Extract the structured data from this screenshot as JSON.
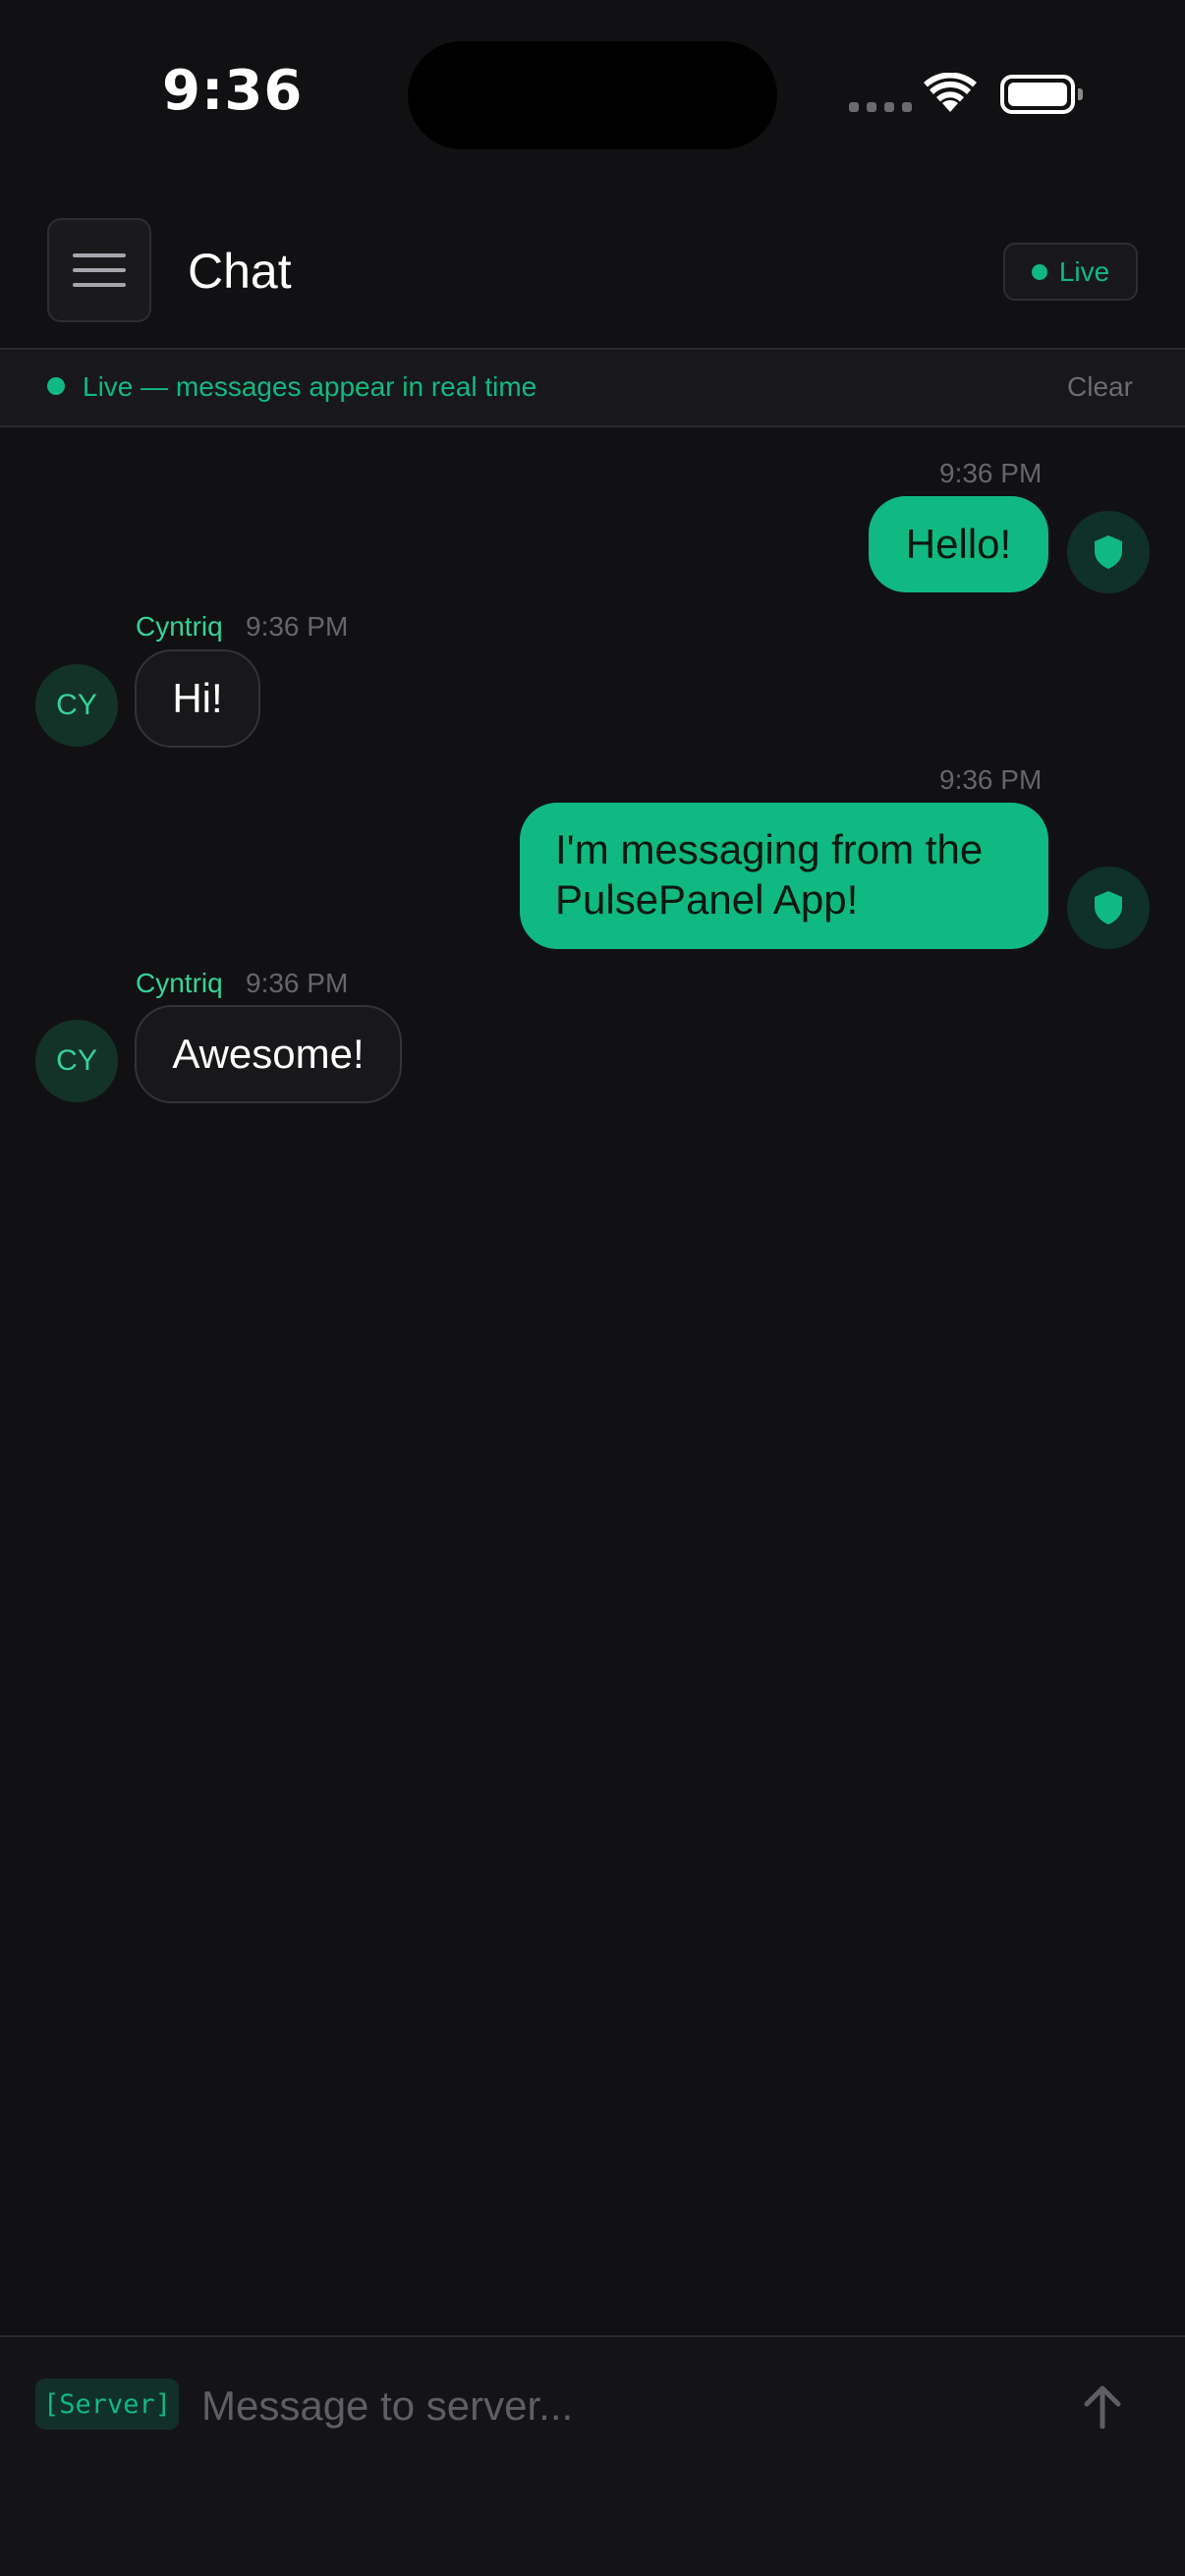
{
  "status_bar": {
    "time": "9:36"
  },
  "header": {
    "title": "Chat",
    "live_label": "Live"
  },
  "banner": {
    "text": "Live — messages appear in real time",
    "clear_label": "Clear"
  },
  "messages": [
    {
      "direction": "outgoing",
      "time": "9:36 PM",
      "text": "Hello!"
    },
    {
      "direction": "incoming",
      "sender": "Cyntriq",
      "initials": "CY",
      "time": "9:36 PM",
      "text": "Hi!"
    },
    {
      "direction": "outgoing",
      "time": "9:36 PM",
      "text": "I'm messaging from the PulsePanel App!"
    },
    {
      "direction": "incoming",
      "sender": "Cyntriq",
      "initials": "CY",
      "time": "9:36 PM",
      "text": "Awesome!"
    }
  ],
  "composer": {
    "target_tag": "[Server]",
    "placeholder": "Message to server...",
    "value": ""
  },
  "icons": {
    "menu": "hamburger-icon",
    "outgoing_avatar": "shield-icon",
    "send": "arrow-up-icon",
    "wifi": "wifi-icon",
    "battery": "battery-icon"
  },
  "colors": {
    "accent": "#10b981",
    "background": "#111113",
    "incoming_bubble": "#18181b"
  }
}
